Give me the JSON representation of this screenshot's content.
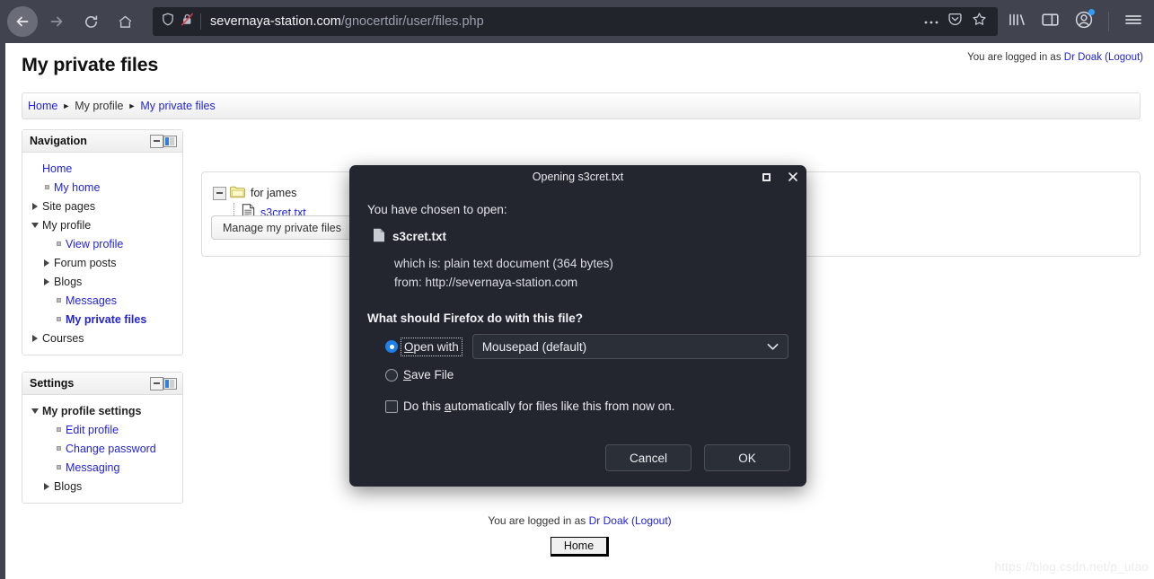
{
  "browser": {
    "nav": {
      "back": "back-button",
      "forward": "forward-button",
      "reload": "reload-button",
      "home": "home-button"
    },
    "url": {
      "domain": "severnaya-station.com",
      "path": "/gnocertdir/user/files.php",
      "shield_icon": "tracking-protection-shield-icon",
      "insecure_icon": "insecure-connection-crossed-lock-icon",
      "more_icon": "page-actions-ellipsis-icon",
      "pocket_icon": "save-to-pocket-icon",
      "bookmark_icon": "bookmark-star-icon"
    },
    "toolbar_right": {
      "library_icon": "library-icon",
      "sidebar_icon": "sidebar-toggle-icon",
      "account_icon": "firefox-account-avatar-icon",
      "menu_icon": "hamburger-menu-icon"
    }
  },
  "page": {
    "title": "My private files",
    "logged_in_prefix": "You are logged in as ",
    "logged_in_user": "Dr Doak",
    "logout_label": "(Logout)",
    "breadcrumb": [
      {
        "label": "Home",
        "link": true
      },
      {
        "label": "My profile",
        "link": false
      },
      {
        "label": "My private files",
        "link": true
      }
    ],
    "breadcrumb_separator": "►"
  },
  "navigation_block": {
    "title": "Navigation",
    "collapse_icon": "collapse-block-icon",
    "dock_icon": "dock-block-icon",
    "items": [
      {
        "label": "Home",
        "indent": 0,
        "marker": "none",
        "style": "link"
      },
      {
        "label": "My home",
        "indent": 1,
        "marker": "bullet",
        "style": "link"
      },
      {
        "label": "Site pages",
        "indent": 0,
        "marker": "right",
        "style": "plain"
      },
      {
        "label": "My profile",
        "indent": 0,
        "marker": "down",
        "style": "plain"
      },
      {
        "label": "View profile",
        "indent": 2,
        "marker": "bullet",
        "style": "link"
      },
      {
        "label": "Forum posts",
        "indent": 1,
        "marker": "right",
        "style": "plain"
      },
      {
        "label": "Blogs",
        "indent": 1,
        "marker": "right",
        "style": "plain"
      },
      {
        "label": "Messages",
        "indent": 2,
        "marker": "bullet",
        "style": "link"
      },
      {
        "label": "My private files",
        "indent": 2,
        "marker": "bullet",
        "style": "boldlink"
      },
      {
        "label": "Courses",
        "indent": 0,
        "marker": "right",
        "style": "plain"
      }
    ]
  },
  "settings_block": {
    "title": "Settings",
    "collapse_icon": "collapse-block-icon",
    "dock_icon": "dock-block-icon",
    "items": [
      {
        "label": "My profile settings",
        "indent": 0,
        "marker": "down",
        "style": "bold"
      },
      {
        "label": "Edit profile",
        "indent": 2,
        "marker": "bullet",
        "style": "link"
      },
      {
        "label": "Change password",
        "indent": 2,
        "marker": "bullet",
        "style": "link"
      },
      {
        "label": "Messaging",
        "indent": 2,
        "marker": "bullet",
        "style": "link"
      },
      {
        "label": "Blogs",
        "indent": 1,
        "marker": "right",
        "style": "plain"
      }
    ]
  },
  "filearea": {
    "folder_icon": "folder-icon",
    "folder_name": "for james",
    "file_icon": "text-file-icon",
    "file_name": "s3cret.txt",
    "manage_button": "Manage my private files"
  },
  "footer": {
    "logged_in_prefix": "You are logged in as ",
    "logged_in_user": "Dr Doak",
    "logout_label": "(Logout)",
    "home_button": "Home",
    "watermark": "https://blog.csdn.net/p_utao"
  },
  "dialog": {
    "title": "Opening s3cret.txt",
    "maximize_icon": "maximize-window-icon",
    "close_icon": "close-window-icon",
    "intro": "You have chosen to open:",
    "file_icon": "text-file-icon",
    "file_name": "s3cret.txt",
    "which_is_label": "which is:",
    "which_is_value": "plain text document (364 bytes)",
    "from_label": "from:",
    "from_value": "http://severnaya-station.com",
    "question": "What should Firefox do with this file?",
    "open_with_label_pre": "",
    "open_with_accesskey": "O",
    "open_with_label_post": "pen with",
    "app_selected": "Mousepad (default)",
    "app_dropdown_icon": "chevron-down-icon",
    "save_accesskey": "S",
    "save_label_post": "ave File",
    "auto_label_pre": "Do this ",
    "auto_accesskey": "a",
    "auto_label_post": "utomatically for files like this from now on.",
    "cancel_button": "Cancel",
    "ok_button": "OK"
  },
  "colors": {
    "chrome_bg": "#41444f",
    "urlbar_bg": "#22242c",
    "dialog_bg": "#23262e",
    "link": "#2323dc",
    "accent_blue": "#1f7fe8"
  }
}
